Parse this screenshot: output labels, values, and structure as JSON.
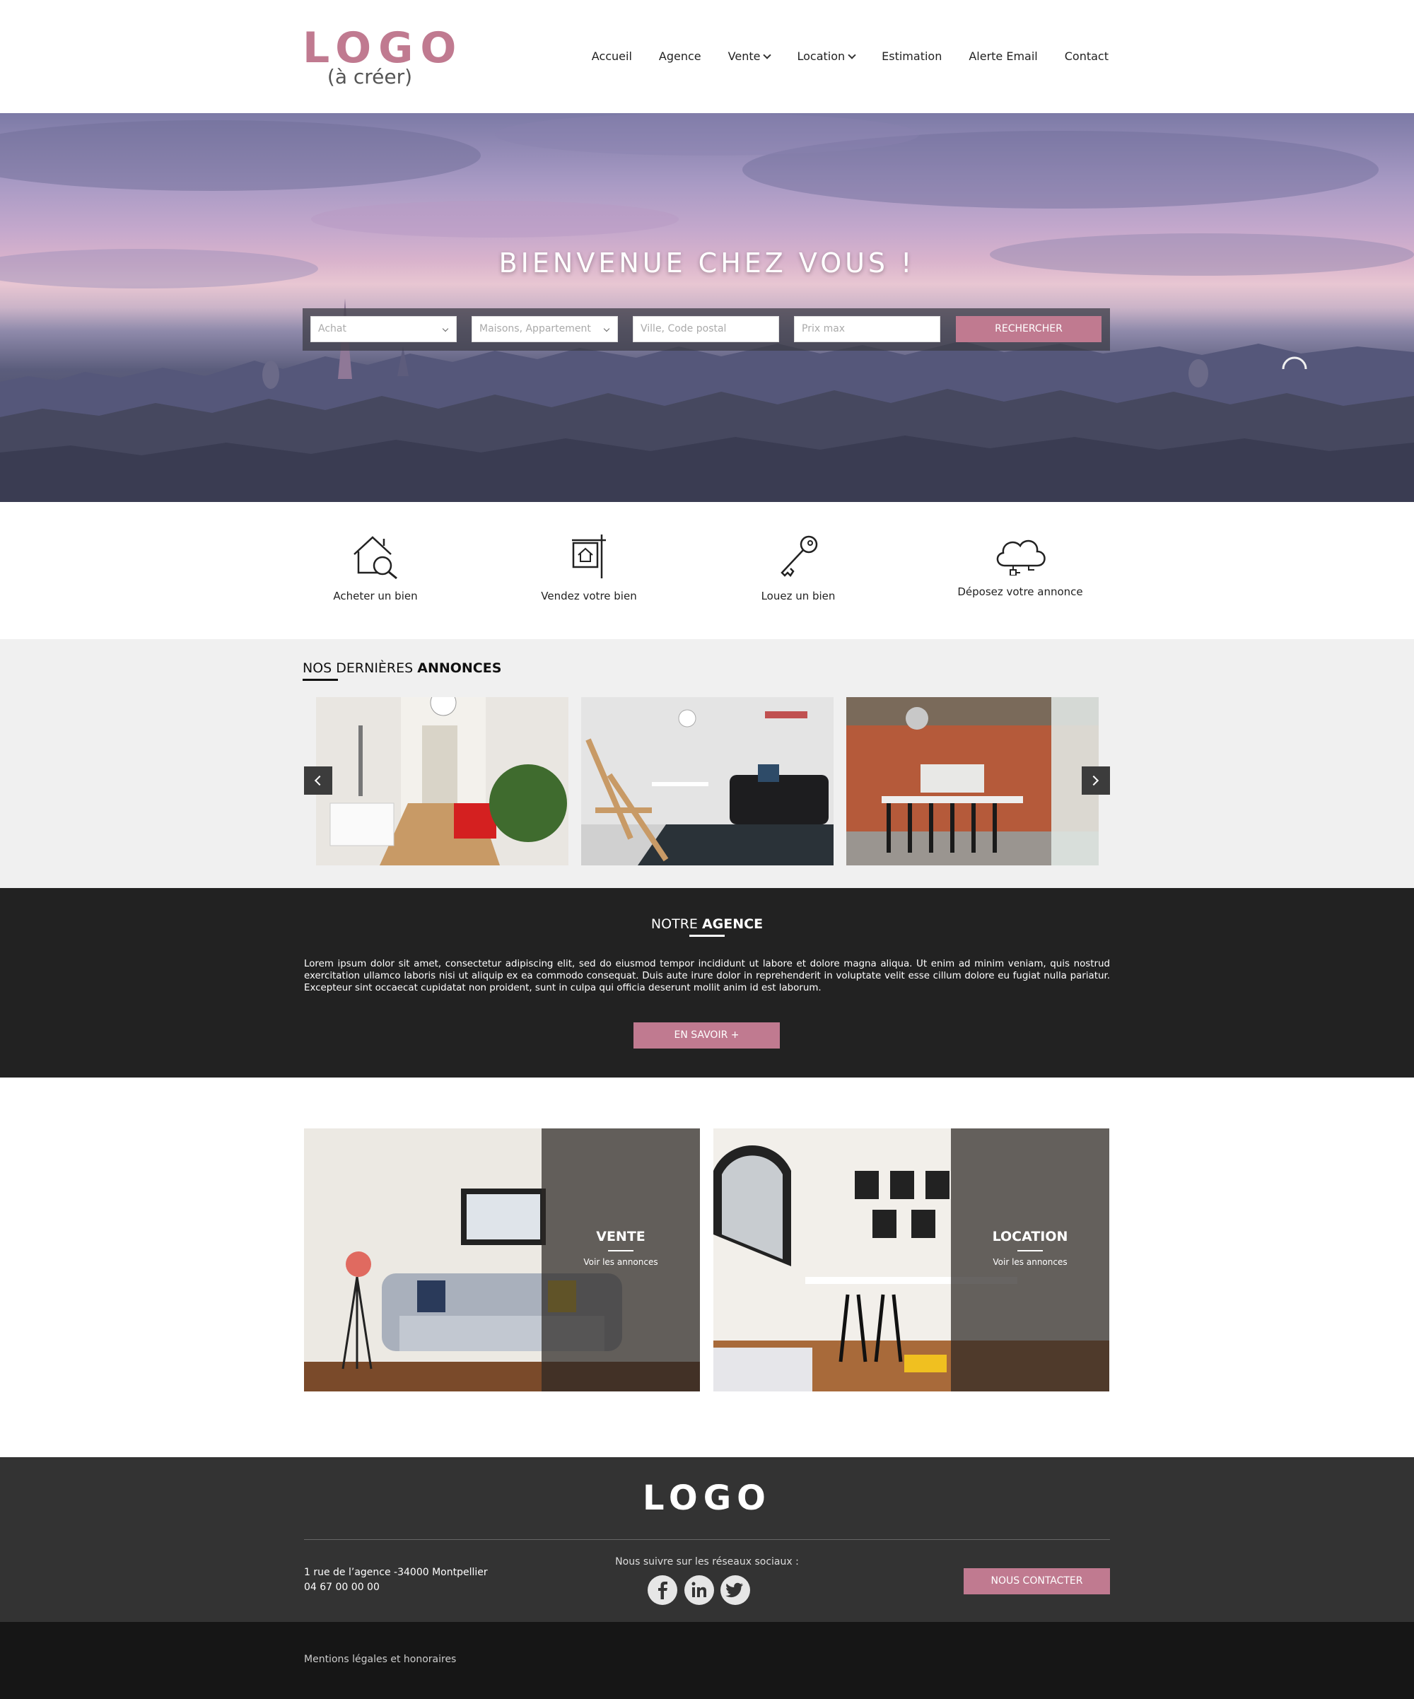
{
  "header": {
    "logo_main": "LOGO",
    "logo_sub": "(à créer)",
    "nav": [
      {
        "label": "Accueil"
      },
      {
        "label": "Agence"
      },
      {
        "label": "Vente"
      },
      {
        "label": "Location"
      },
      {
        "label": "Estimation"
      },
      {
        "label": "Alerte Email"
      },
      {
        "label": "Contact"
      }
    ]
  },
  "hero": {
    "title": "BIENVENUE CHEZ VOUS !",
    "search": {
      "transaction_value": "Achat",
      "type_value": "Maisons, Appartement",
      "city_placeholder": "Ville, Code postal",
      "price_placeholder": "Prix max",
      "button_label": "RECHERCHER"
    }
  },
  "services": [
    {
      "label": "Acheter un bien",
      "icon": "house-search-icon"
    },
    {
      "label": "Vendez votre bien",
      "icon": "sale-sign-icon"
    },
    {
      "label": "Louez un bien",
      "icon": "key-icon"
    },
    {
      "label": "Déposez votre annonce",
      "icon": "cloud-upload-icon"
    }
  ],
  "listings": {
    "title_plain": "NOS DERNIÈRES ",
    "title_bold": "ANNONCES"
  },
  "agency": {
    "title_plain": "NOTRE ",
    "title_bold": "AGENCE",
    "text": "Lorem ipsum dolor sit amet, consectetur adipiscing elit, sed do eiusmod tempor incididunt ut labore et dolore magna aliqua. Ut enim ad minim veniam, quis nostrud exercitation ullamco laboris nisi ut aliquip ex ea commodo consequat. Duis aute irure dolor in reprehenderit in voluptate velit esse cillum dolore eu fugiat nulla pariatur. Excepteur sint occaecat cupidatat non proident, sunt in culpa qui officia deserunt mollit anim id est laborum.",
    "button_label": "EN SAVOIR +"
  },
  "tiles": [
    {
      "title": "VENTE",
      "subtitle": "Voir les annonces"
    },
    {
      "title": "LOCATION",
      "subtitle": "Voir les annonces"
    }
  ],
  "footer": {
    "logo": "LOGO",
    "address_line1": "1 rue de l’agence -34000 Montpellier",
    "address_line2": "04 67 00 00 00",
    "social_label": "Nous suivre sur les réseaux sociaux :",
    "social": [
      "facebook-icon",
      "linkedin-icon",
      "twitter-icon"
    ],
    "contact_button": "NOUS CONTACTER",
    "legal": "Mentions légales et honoraires"
  },
  "colors": {
    "accent": "#c07a90",
    "dark": "#222222",
    "footer": "#333333",
    "bottom": "#161616",
    "listings_bg": "#f0f0f0"
  }
}
